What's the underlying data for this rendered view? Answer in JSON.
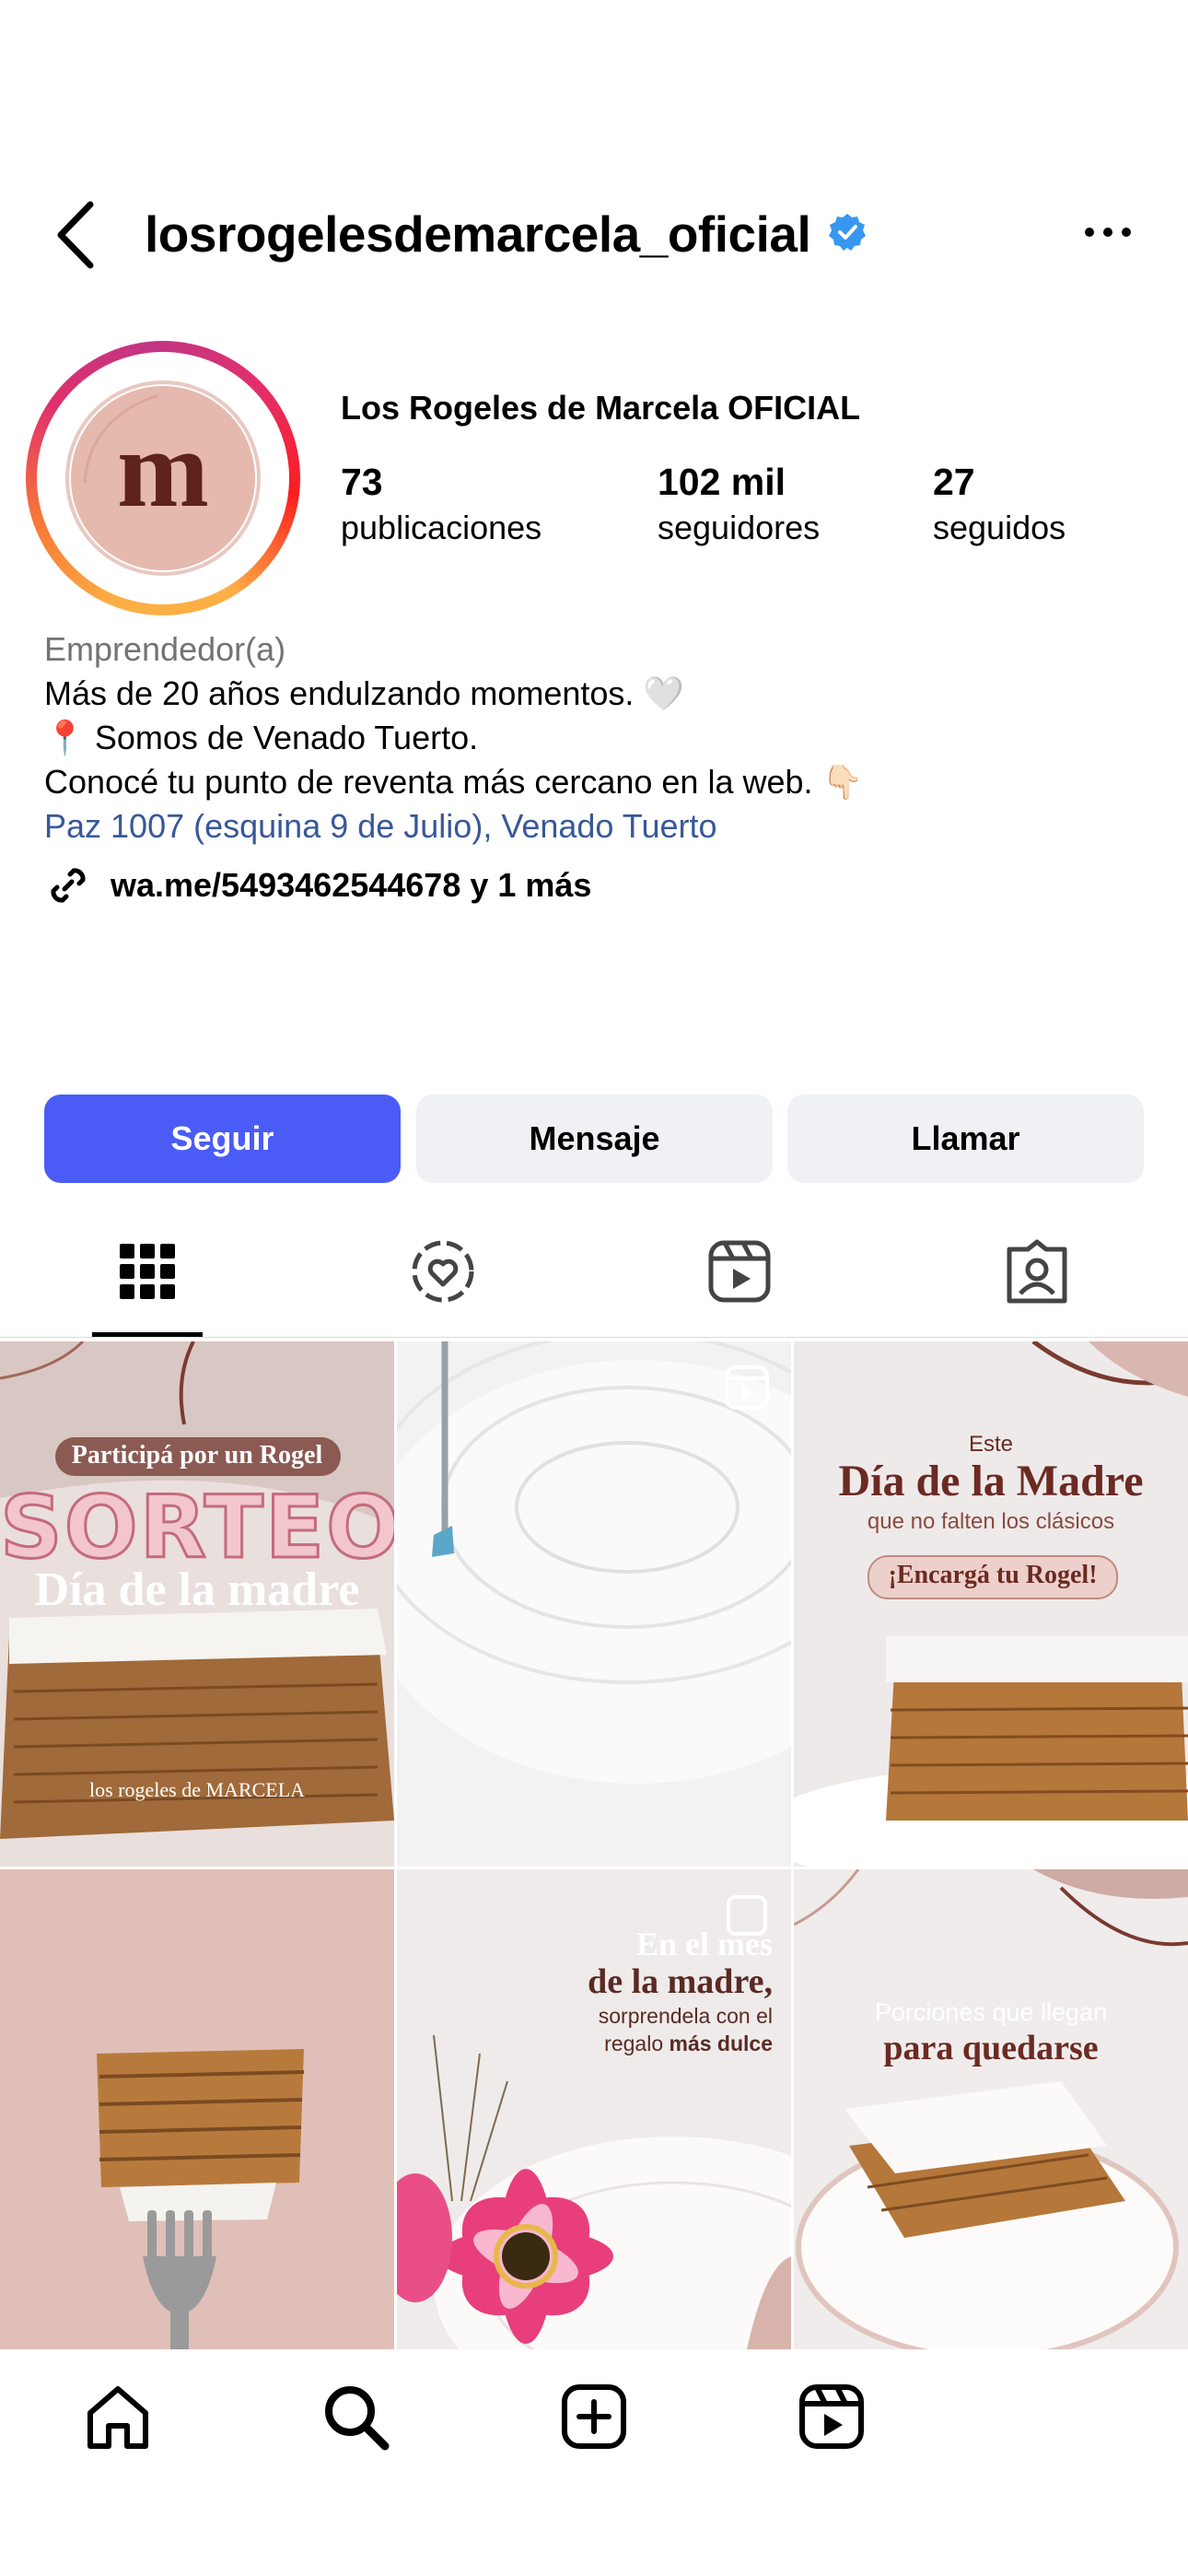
{
  "header": {
    "username": "losrogelesdemarcela_oficial"
  },
  "profile": {
    "display_name": "Los Rogeles de Marcela OFICIAL",
    "avatar_letter": "m",
    "stats": [
      {
        "value": "73",
        "label": "publicaciones"
      },
      {
        "value": "102 mil",
        "label": "seguidores"
      },
      {
        "value": "27",
        "label": "seguidos"
      }
    ]
  },
  "bio": {
    "category": "Emprendedor(a)",
    "lines": [
      "Más de 20 años endulzando momentos. 🤍",
      "📍 Somos de Venado Tuerto.",
      "Conocé tu punto de reventa más cercano en la web. 👇🏻"
    ],
    "address": "Paz 1007 (esquina 9 de Julio), Venado Tuerto",
    "link": "wa.me/5493462544678 y 1 más"
  },
  "actions": {
    "follow": "Seguir",
    "message": "Mensaje",
    "call": "Llamar"
  },
  "posts": [
    {
      "line1": "Participá por un Rogel",
      "line2": "SORTEO",
      "line3": "Día de la madre",
      "brand": "los rogeles de MARCELA"
    },
    {
      "type": "reel"
    },
    {
      "line1": "Este",
      "line2": "Día de la Madre",
      "line3": "que no falten los clásicos",
      "line4": "¡Encargá tu Rogel!"
    },
    {},
    {
      "line1": "En el mes",
      "line2": "de la madre,",
      "line3": "sorprendela con el",
      "line4_pre": "regalo ",
      "line4_bold": "más dulce"
    },
    {
      "line1": "Porciones que llegan",
      "line2": "para quedarse"
    }
  ],
  "colors": {
    "accent": "#4a5cf5",
    "link": "#385898",
    "muted": "#737373",
    "brand_brown": "#6b2a22",
    "brand_pink": "#e8c4bd"
  }
}
